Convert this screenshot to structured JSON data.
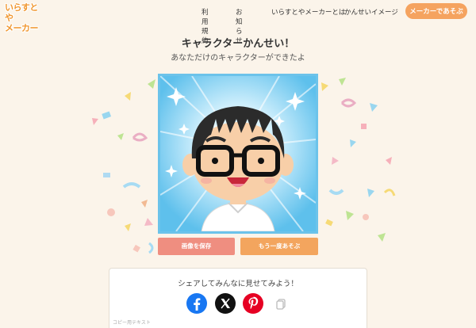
{
  "header": {
    "logo_line1": "いらすとや",
    "logo_line2": "メーカー",
    "nav": [
      {
        "label": "利用規約"
      },
      {
        "label": "お知らせ"
      },
      {
        "label": "いらすとやメーカーとは"
      },
      {
        "label": "かんせいイメージ"
      }
    ],
    "cta_label": "メーカーであそぶ"
  },
  "main": {
    "title": "キャラクターかんせい！",
    "subtitle": "あなただけのキャラクターができたよ"
  },
  "actions": {
    "save_label": "画像を保存",
    "again_label": "もう一度あそぶ"
  },
  "share": {
    "title": "シェアしてみんなに見せてみよう！",
    "copy_text_label": "コピー用テキスト",
    "icons": [
      "facebook-icon",
      "x-icon",
      "pinterest-icon",
      "copy-icon"
    ]
  },
  "colors": {
    "accent": "#f5a35f",
    "save": "#ef8e80",
    "again": "#f3a55e",
    "background": "#fbf4ea",
    "card_border": "#6cc3ea"
  }
}
